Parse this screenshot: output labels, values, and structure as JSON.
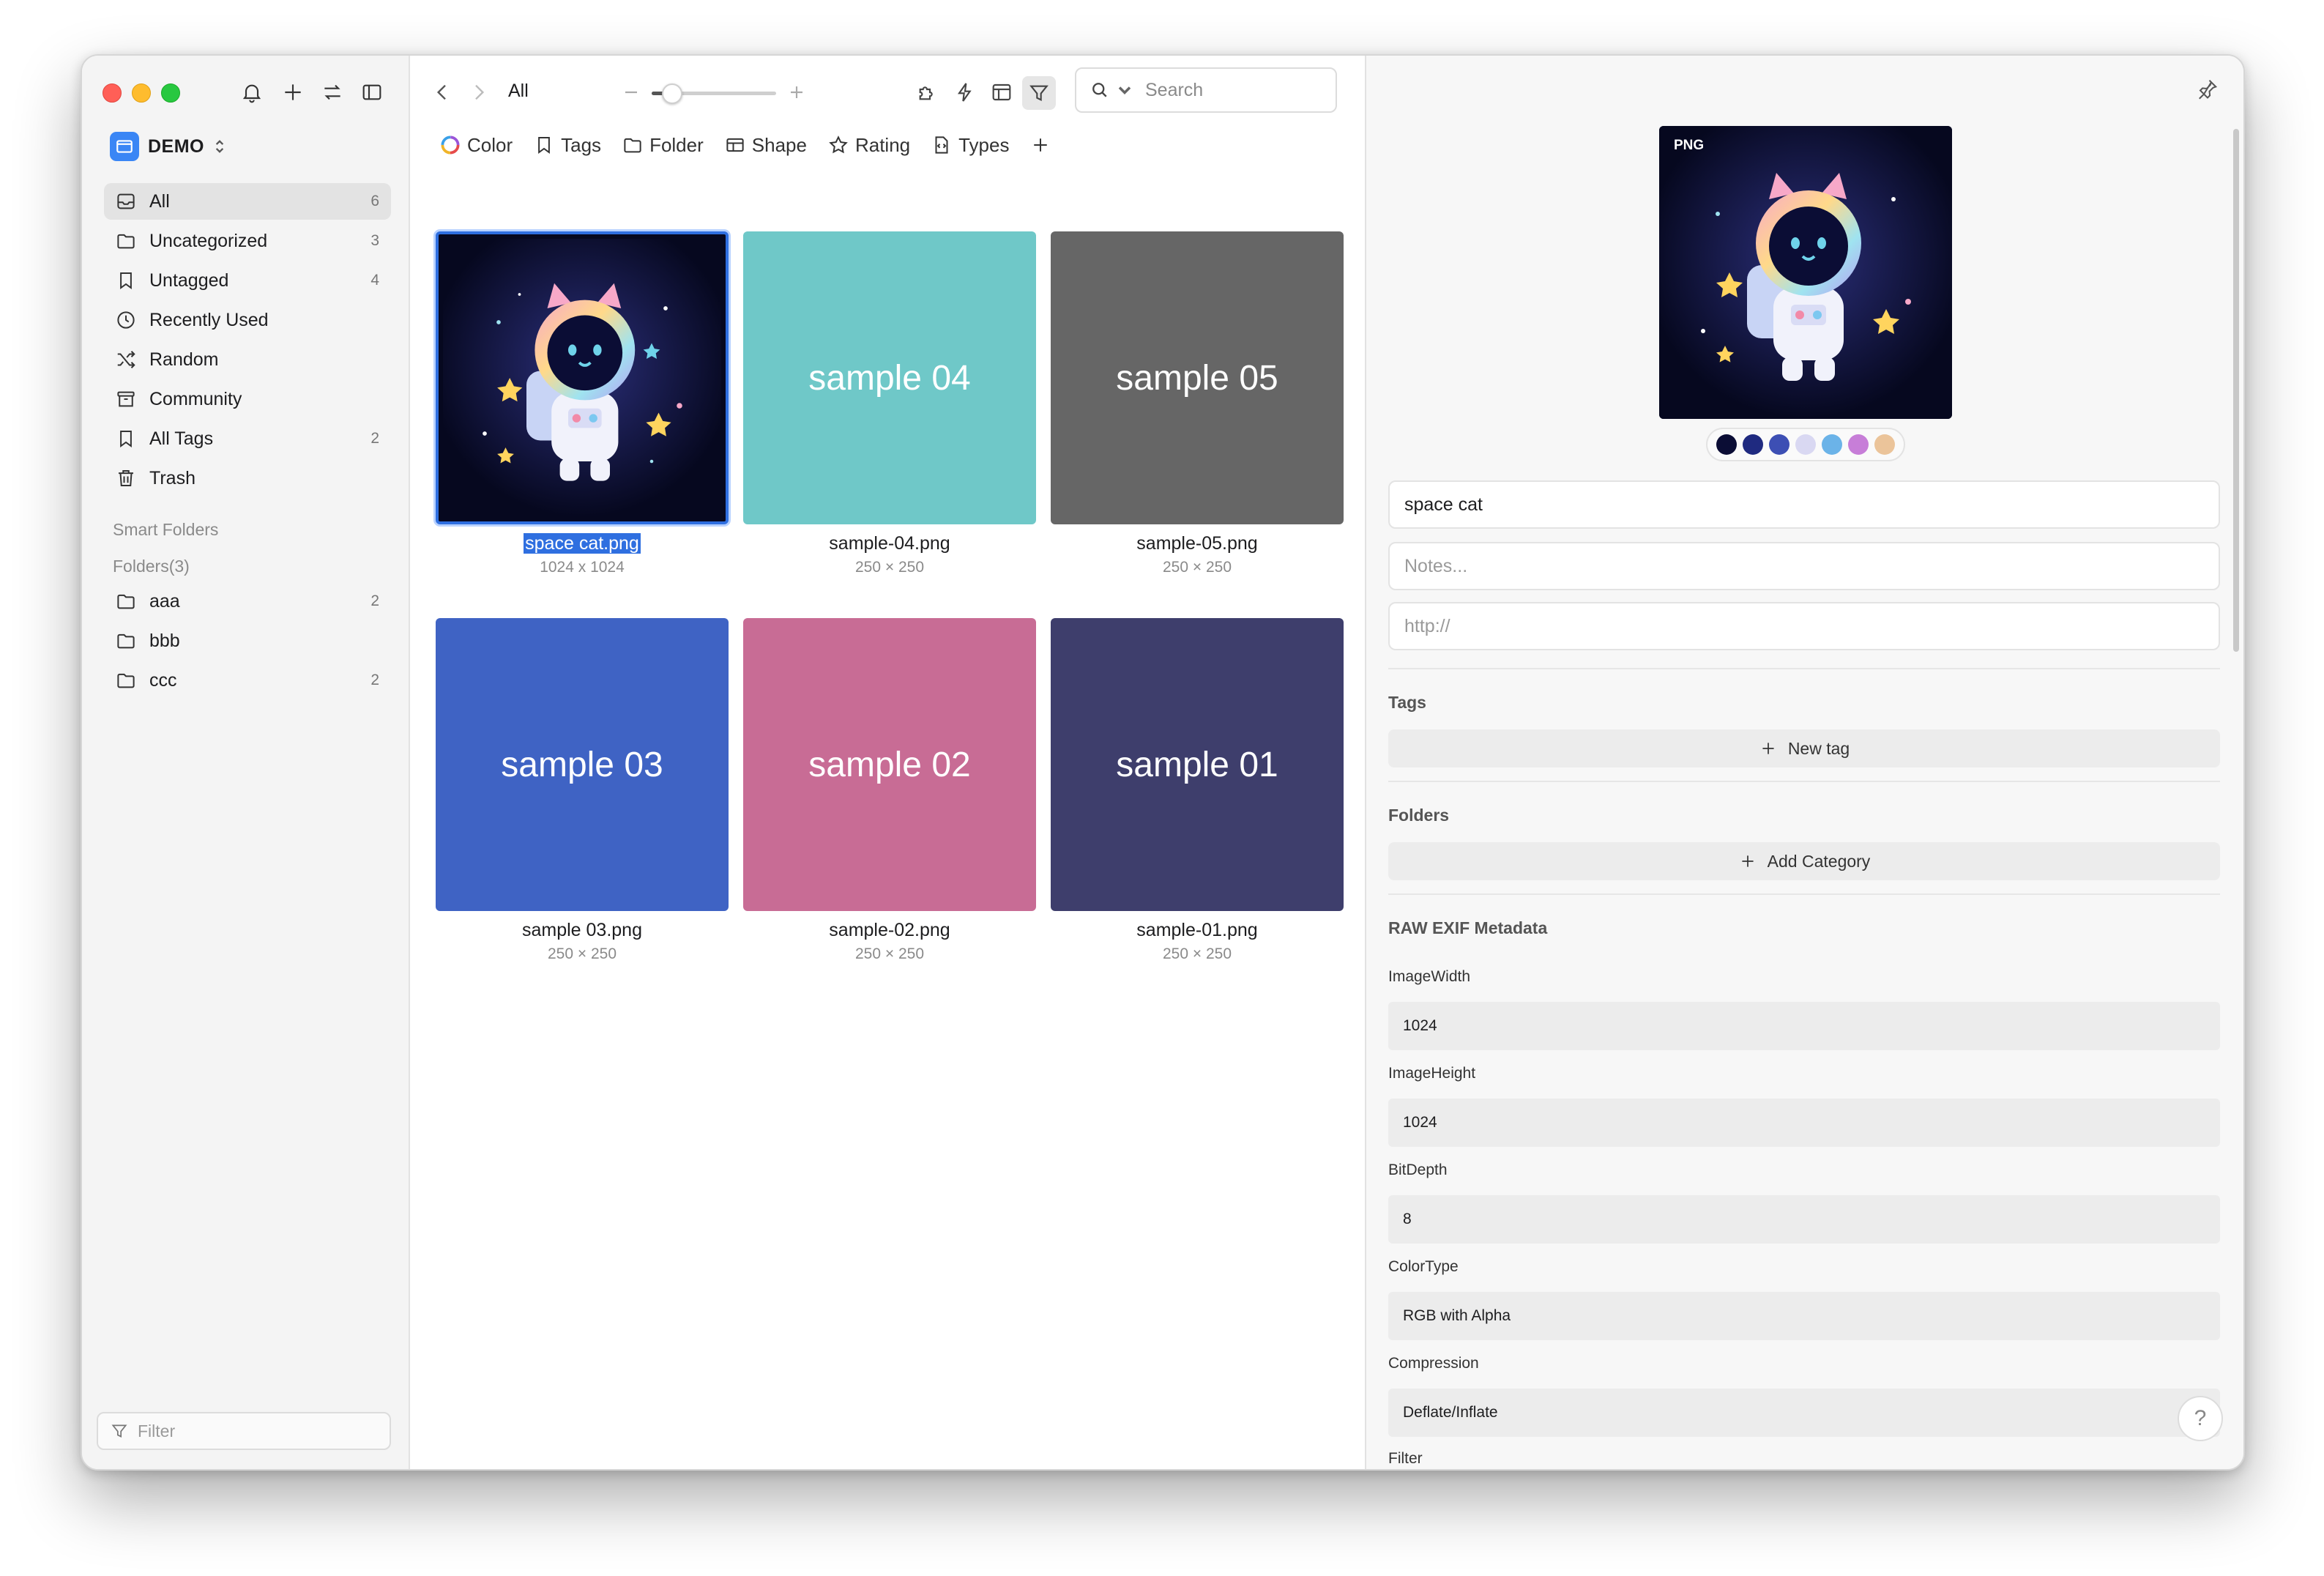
{
  "library": {
    "name": "DEMO"
  },
  "sidebar": {
    "items": [
      {
        "label": "All",
        "count": "6"
      },
      {
        "label": "Uncategorized",
        "count": "3"
      },
      {
        "label": "Untagged",
        "count": "4"
      },
      {
        "label": "Recently Used",
        "count": ""
      },
      {
        "label": "Random",
        "count": ""
      },
      {
        "label": "Community",
        "count": ""
      },
      {
        "label": "All Tags",
        "count": "2"
      },
      {
        "label": "Trash",
        "count": ""
      }
    ],
    "smart_folders_label": "Smart Folders",
    "folders_label": "Folders(3)",
    "folders": [
      {
        "label": "aaa",
        "count": "2"
      },
      {
        "label": "bbb",
        "count": ""
      },
      {
        "label": "ccc",
        "count": "2"
      }
    ],
    "filter_placeholder": "Filter"
  },
  "toolbar": {
    "breadcrumb": "All",
    "zoom_level": 0.15,
    "search_placeholder": "Search"
  },
  "filters": [
    "Color",
    "Tags",
    "Folder",
    "Shape",
    "Rating",
    "Types"
  ],
  "grid": {
    "items": [
      {
        "name": "space cat.png",
        "dims": "1024 x 1024",
        "thumb_text": "",
        "color": "#06081f",
        "selected": true
      },
      {
        "name": "sample-04.png",
        "dims": "250 × 250",
        "thumb_text": "sample 04",
        "color": "#6fc8c8"
      },
      {
        "name": "sample-05.png",
        "dims": "250 × 250",
        "thumb_text": "sample 05",
        "color": "#666666"
      },
      {
        "name": "sample 03.png",
        "dims": "250 × 250",
        "thumb_text": "sample 03",
        "color": "#3f63c4"
      },
      {
        "name": "sample-02.png",
        "dims": "250 × 250",
        "thumb_text": "sample 02",
        "color": "#c86c95"
      },
      {
        "name": "sample-01.png",
        "dims": "250 × 250",
        "thumb_text": "sample 01",
        "color": "#3e3e6c"
      }
    ]
  },
  "inspector": {
    "badge": "PNG",
    "palette": [
      "#0b0d35",
      "#1f2a80",
      "#3d4fb4",
      "#d9d8f2",
      "#6bb3e8",
      "#c77ed8",
      "#ebc49a"
    ],
    "name_value": "space cat",
    "notes_placeholder": "Notes...",
    "url_placeholder": "http://",
    "tags_label": "Tags",
    "new_tag_label": "New tag",
    "folders_label": "Folders",
    "add_category_label": "Add Category",
    "exif_label": "RAW EXIF Metadata",
    "exif": [
      {
        "key": "ImageWidth",
        "value": "1024"
      },
      {
        "key": "ImageHeight",
        "value": "1024"
      },
      {
        "key": "BitDepth",
        "value": "8"
      },
      {
        "key": "ColorType",
        "value": "RGB with Alpha"
      },
      {
        "key": "Compression",
        "value": "Deflate/Inflate"
      },
      {
        "key": "Filter",
        "value": ""
      }
    ],
    "help_label": "?"
  }
}
